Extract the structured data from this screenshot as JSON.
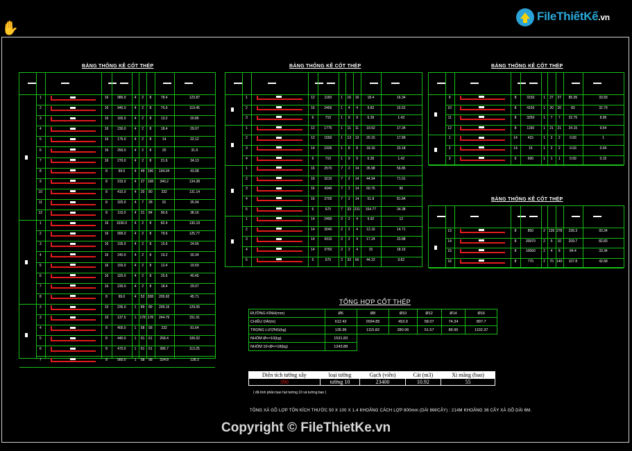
{
  "logo": {
    "brand": "FileThiếtKế",
    "suffix": ".vn"
  },
  "titles": {
    "t1": "BẢNG THỐNG KÊ CỐT THÉP",
    "t2": "BẢNG THỐNG KÊ CỐT THÉP",
    "t3": "BẢNG THỐNG KÊ CỐT THÉP",
    "t4": "BẢNG THỐNG KÊ CỐT THÉP"
  },
  "table1": {
    "rows": [
      [
        "1",
        "16",
        "980.0",
        "4",
        "2",
        "8",
        "78.4",
        "123.87"
      ],
      [
        "2",
        "16",
        "945.0",
        "4",
        "2",
        "8",
        "75.6",
        "119.45"
      ],
      [
        "3",
        "16",
        "165.0",
        "4",
        "2",
        "8",
        "13.2",
        "20.86"
      ],
      [
        "4",
        "16",
        "230.0",
        "4",
        "2",
        "8",
        "18.4",
        "29.07"
      ],
      [
        "5",
        "16",
        "175.0",
        "4",
        "2",
        "8",
        "14",
        "22.12"
      ],
      [
        "6",
        "16",
        "250.0",
        "4",
        "2",
        "8",
        "20",
        "31.6"
      ],
      [
        "7",
        "16",
        "270.0",
        "4",
        "2",
        "8",
        "21.6",
        "34.13"
      ],
      [
        "8",
        "8",
        "99.0",
        "4",
        "49",
        "196",
        "194.04",
        "43.08"
      ],
      [
        "9",
        "8",
        "315.0",
        "4",
        "27",
        "108",
        "340.2",
        "134.38"
      ],
      [
        "10",
        "8",
        "415.0",
        "4",
        "20",
        "80",
        "332",
        "131.14"
      ],
      [
        "11",
        "8",
        "325.0",
        "4",
        "7",
        "28",
        "91",
        "35.94"
      ],
      [
        "12",
        "8",
        "115.0",
        "4",
        "21",
        "84",
        "96.6",
        "38.16"
      ],
      [
        "1",
        "16",
        "1030.0",
        "4",
        "2",
        "8",
        "82.4",
        "130.19"
      ],
      [
        "2",
        "16",
        "995.0",
        "4",
        "2",
        "8",
        "79.6",
        "125.77"
      ],
      [
        "3",
        "16",
        "195.0",
        "4",
        "2",
        "8",
        "15.6",
        "24.65"
      ],
      [
        "4",
        "16",
        "240.0",
        "4",
        "2",
        "8",
        "19.2",
        "30.34"
      ],
      [
        "5",
        "16",
        "155.0",
        "4",
        "2",
        "8",
        "12.4",
        "19.59"
      ],
      [
        "6",
        "16",
        "320.0",
        "4",
        "2",
        "8",
        "25.6",
        "40.45"
      ],
      [
        "7",
        "16",
        "230.0",
        "4",
        "2",
        "8",
        "18.4",
        "29.07"
      ],
      [
        "8",
        "8",
        "99.0",
        "4",
        "52",
        "208",
        "205.92",
        "45.71"
      ],
      [
        "2",
        "10",
        "235.0",
        "1",
        "89",
        "89",
        "209.15",
        "129.05"
      ],
      [
        "3",
        "10",
        "137.5",
        "1",
        "178",
        "178",
        "244.75",
        "151.01"
      ],
      [
        "4",
        "8",
        "400.0",
        "1",
        "58",
        "58",
        "232",
        "91.64"
      ],
      [
        "5",
        "8",
        "440.0",
        "1",
        "61",
        "61",
        "268.4",
        "106.02"
      ],
      [
        "6",
        "8",
        "470.0",
        "1",
        "61",
        "61",
        "286.7",
        "113.25"
      ],
      [
        "7",
        "8",
        "560.0",
        "1",
        "58",
        "58",
        "324.8",
        "128.3"
      ]
    ]
  },
  "table2": {
    "rows": [
      [
        "1",
        "12",
        "1150",
        "1",
        "16",
        "16",
        "18.4",
        "16.34"
      ],
      [
        "2",
        "16",
        "2455",
        "1",
        "4",
        "4",
        "9.82",
        "15.52"
      ],
      [
        "3",
        "6",
        "710",
        "1",
        "9",
        "9",
        "6.39",
        "1.42"
      ],
      [
        "1",
        "12",
        "1775",
        "1",
        "11",
        "11",
        "19.52",
        "17.34"
      ],
      [
        "2",
        "12",
        "1550",
        "1",
        "13",
        "13",
        "20.15",
        "17.89"
      ],
      [
        "3",
        "14",
        "2335",
        "1",
        "8",
        "8",
        "18.16",
        "23.18"
      ],
      [
        "4",
        "6",
        "710",
        "1",
        "9",
        "9",
        "6.39",
        "1.42"
      ],
      [
        "1",
        "16",
        "2570",
        "7",
        "2",
        "14",
        "35.98",
        "56.85"
      ],
      [
        "2",
        "16",
        "3210",
        "7",
        "2",
        "14",
        "44.94",
        "71.01"
      ],
      [
        "3",
        "16",
        "4340",
        "7",
        "2",
        "14",
        "60.76",
        "96"
      ],
      [
        "4",
        "16",
        "3700",
        "7",
        "2",
        "14",
        "51.8",
        "81.84"
      ],
      [
        "5",
        "6",
        "670",
        "7",
        "33",
        "231",
        "154.77",
        "34.38"
      ],
      [
        "1",
        "14",
        "2490",
        "2",
        "2",
        "4",
        "9.92",
        "12"
      ],
      [
        "2",
        "14",
        "3040",
        "2",
        "2",
        "4",
        "12.16",
        "14.71"
      ],
      [
        "3",
        "14",
        "4310",
        "2",
        "2",
        "4",
        "17.24",
        "20.88"
      ],
      [
        "4",
        "14",
        "3750",
        "2",
        "2",
        "4",
        "15",
        "18.15"
      ],
      [
        "5",
        "6",
        "670",
        "2",
        "33",
        "66",
        "44.22",
        "9.82"
      ]
    ]
  },
  "table3": {
    "rows": [
      [
        "9",
        "8",
        "3150",
        "1",
        "27",
        "27",
        "85.05",
        "33.59"
      ],
      [
        "10",
        "8",
        "4150",
        "1",
        "20",
        "20",
        "83",
        "32.79"
      ],
      [
        "11",
        "8",
        "3250",
        "1",
        "7",
        "7",
        "22.75",
        "8.99"
      ],
      [
        "12",
        "8",
        "1150",
        "1",
        "21",
        "21",
        "24.15",
        "9.54"
      ],
      [
        "1",
        "14",
        "415",
        "1",
        "2",
        "2",
        "0.83",
        "1"
      ],
      [
        "2",
        "14",
        "15",
        "1",
        "2",
        "2",
        "0.03",
        "0.04"
      ],
      [
        "3",
        "6",
        "690",
        "1",
        "1",
        "1",
        "0.69",
        "0.15"
      ]
    ]
  },
  "table4": {
    "rows": [
      [
        "13",
        "8",
        "850",
        "2",
        "139",
        "278",
        "236.3",
        "93.34"
      ],
      [
        "14",
        "8",
        "20970",
        "2",
        "5",
        "10",
        "209.7",
        "82.83"
      ],
      [
        "15",
        "8",
        "10560",
        "2",
        "4",
        "8",
        "84.4",
        "33.34"
      ],
      [
        "16",
        "8",
        "770",
        "2",
        "70",
        "140",
        "107.8",
        "42.58"
      ]
    ]
  },
  "summary": {
    "title": "TỔNG HỢP CỐT THÉP",
    "header": [
      "ĐƯỜNG KÍNH(mm)",
      "Ø6",
      "Ø8",
      "Ø10",
      "Ø12",
      "Ø14",
      "Ø16"
    ],
    "length": [
      "CHIỀU DÀI(m)",
      "612.42",
      "2694.85",
      "453.9",
      "58.07",
      "74.34",
      "897.7"
    ],
    "weight": [
      "TRỌNG LƯỢNG(kg)",
      "135.96",
      "1115.82",
      "280.06",
      "51.57",
      "89.95",
      "1102.37"
    ],
    "grp1": [
      "NHÓM Ø<=10(kg)",
      "1531.83"
    ],
    "grp2": [
      "NHÓM 10<Ø<=18(kg)",
      "1243.88"
    ]
  },
  "materials": {
    "header": [
      "Diện tích tường xây",
      "loại tường",
      "Gạch (viên)",
      "Cát (m3)",
      "Xi măng (bao)"
    ],
    "values": [
      "390",
      "tường 10",
      "23400",
      "10.92",
      "55"
    ],
    "note": "( đã tính phần bao hụt tường 10 và tường bao )"
  },
  "note": "TÔNG XÀ GỒ LỢP TÔN KÍCH THƯỚC 50 X 100 X 1.4 KHOẢNG CÁCH LỢP 800mm (DÀI 6M/CÂY) : 214M KHOẢNG 36 CÂY XÀ GỒ DÀI 6M.",
  "copyright": "Copyright © FileThietKe.vn",
  "colors": {
    "grid": "#19c019",
    "rebar": "#e31b1b",
    "background": "#000000",
    "logo": "#28a8d8"
  }
}
